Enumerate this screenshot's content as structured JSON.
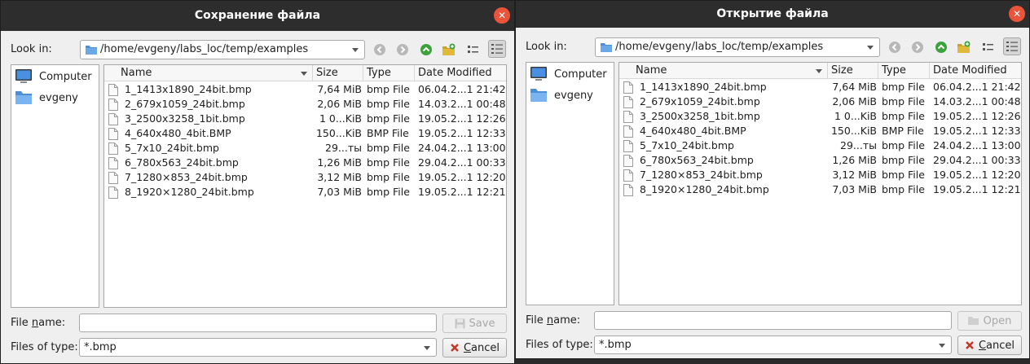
{
  "save_dialog": {
    "title": "Сохранение файла",
    "look_in_label": "Look in:",
    "path": "/home/evgeny/labs_loc/temp/examples",
    "sidebar": [
      {
        "label": "Computer",
        "icon": "computer-icon"
      },
      {
        "label": "evgeny",
        "icon": "folder-icon"
      }
    ],
    "file_name_label_pre": "File ",
    "file_name_label_mn": "n",
    "file_name_label_post": "ame:",
    "file_name_value": "",
    "files_of_type_label": "Files of type:",
    "files_of_type_value": "*.bmp",
    "primary_button": "Save",
    "cancel_button_mn": "C",
    "cancel_button_rest": "ancel"
  },
  "open_dialog": {
    "title": "Открытие файла",
    "look_in_label": "Look in:",
    "path": "/home/evgeny/labs_loc/temp/examples",
    "sidebar": [
      {
        "label": "Computer",
        "icon": "computer-icon"
      },
      {
        "label": "evgeny",
        "icon": "folder-icon"
      }
    ],
    "file_name_label_pre": "File ",
    "file_name_label_mn": "n",
    "file_name_label_post": "ame:",
    "file_name_value": "",
    "files_of_type_label": "Files of type:",
    "files_of_type_value": "*.bmp",
    "primary_button": "Open",
    "cancel_button_mn": "C",
    "cancel_button_rest": "ancel"
  },
  "columns": {
    "name": "Name",
    "size": "Size",
    "type": "Type",
    "date": "Date Modified"
  },
  "files": [
    {
      "name": "1_1413x1890_24bit.bmp",
      "size": "7,64 MiB",
      "type": "bmp File",
      "date": "06.04.2...1 21:42"
    },
    {
      "name": "2_679x1059_24bit.bmp",
      "size": "2,06 MiB",
      "type": "bmp File",
      "date": "14.03.2...1 00:48"
    },
    {
      "name": "3_2500x3258_1bit.bmp",
      "size": "1 0...KiB",
      "type": "bmp File",
      "date": "19.05.2...1 12:26"
    },
    {
      "name": "4_640x480_4bit.BMP",
      "size": "150...KiB",
      "type": "BMP File",
      "date": "19.05.2...1 12:33"
    },
    {
      "name": "5_7x10_24bit.bmp",
      "size": "29...ты",
      "type": "bmp File",
      "date": "24.04.2...1 13:00"
    },
    {
      "name": "6_780x563_24bit.bmp",
      "size": "1,26 MiB",
      "type": "bmp File",
      "date": "29.04.2...1 00:33"
    },
    {
      "name": "7_1280×853_24bit.bmp",
      "size": "3,12 MiB",
      "type": "bmp File",
      "date": "19.05.2...1 12:20"
    },
    {
      "name": "8_1920×1280_24bit.bmp",
      "size": "7,03 MiB",
      "type": "bmp File",
      "date": "19.05.2...1 12:21"
    }
  ],
  "colors": {
    "titlebar": "#2d2d2d",
    "close": "#e9543a",
    "folder": "#4d8fd6",
    "go_up": "#3da23d"
  }
}
